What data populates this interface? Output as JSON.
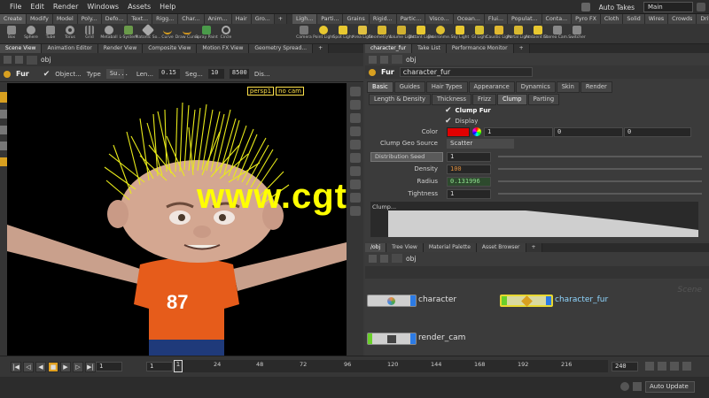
{
  "menubar": {
    "items": [
      "File",
      "Edit",
      "Render",
      "Windows",
      "Assets",
      "Help"
    ],
    "auto_takes": "Auto Takes",
    "desktop": "Main"
  },
  "shelf": {
    "left_tabs": [
      "Create",
      "Modify",
      "Model",
      "Poly...",
      "Defo...",
      "Text...",
      "Rigg...",
      "Char...",
      "Anim...",
      "Hair",
      "Gro..."
    ],
    "left_tools": [
      "Box",
      "Sphere",
      "Tube",
      "Torus",
      "Grid",
      "Metaball",
      "L-System",
      "Platonic So...",
      "Curve",
      "Draw Curve",
      "Spray Paint",
      "Circle"
    ],
    "right_tabs": [
      "Ligh...",
      "Parti...",
      "Grains",
      "Rigid...",
      "Partic...",
      "Visco...",
      "Ocean...",
      "Flui...",
      "Populat...",
      "Conta...",
      "Pyro FX",
      "Cloth",
      "Solid",
      "Wires",
      "Crowds",
      "Drive..."
    ],
    "right_tools": [
      "Camera",
      "Point Light",
      "Spot Light",
      "Area Light",
      "Geometry L...",
      "Volume Light",
      "Distant Light",
      "Environme...",
      "Sky Light",
      "GI Light",
      "Caustic Light",
      "Portal Light",
      "Ambient Li...",
      "Stereo Cam...",
      "Switcher"
    ]
  },
  "left_pane": {
    "tabs": [
      "Scene View",
      "Animation Editor",
      "Render View",
      "Composite View",
      "Motion FX View",
      "Geometry Spread..."
    ],
    "path": "obj",
    "toolbar": {
      "node": "Fur",
      "object_label": "Object...",
      "type_label": "Type",
      "type_value": "Su...",
      "length_label": "Len...",
      "length_value": "0.15",
      "segments_label": "Seg...",
      "segments_value": "10",
      "count_value": "8500",
      "dis_label": "Dis..."
    },
    "camera_menu": "persp1",
    "cam_menu": "no cam"
  },
  "param_pane": {
    "tabs": [
      "character_fur",
      "Take List",
      "Performance Monitor"
    ],
    "path": "obj",
    "node_type": "Fur",
    "node_name": "character_fur",
    "main_tabs": [
      "Basic",
      "Guides",
      "Hair Types",
      "Appearance",
      "Dynamics",
      "Skin",
      "Render"
    ],
    "sub_tabs": [
      "Length & Density",
      "Thickness",
      "Frizz",
      "Clump",
      "Parting"
    ],
    "active_sub_tab": "Clump",
    "params": {
      "clump_fur": "Clump Fur",
      "display": "Display",
      "color_label": "Color",
      "color_r": "1",
      "color_g": "0",
      "color_b": "0",
      "geo_source_label": "Clump Geo Source",
      "geo_source_value": "Scatter",
      "dist_seed_label": "Distribution Seed",
      "dist_seed_value": "1",
      "density_label": "Density",
      "density_value": "100",
      "radius_label": "Radius",
      "radius_value": "0.131996",
      "tightness_label": "Tightness",
      "tightness_value": "1",
      "clump_label": "Clump..."
    },
    "colors": {
      "swatch": "#e00000"
    }
  },
  "network_pane": {
    "tabs": [
      "/obj",
      "Tree View",
      "Material Palette",
      "Asset Browser"
    ],
    "path": "obj",
    "scene_label": "Scene",
    "nodes": [
      {
        "name": "character",
        "color": "#cfcfcf",
        "flag": "#2c7be5"
      },
      {
        "name": "character_fur",
        "color": "#d9d9a0",
        "flag": "#2c7be5"
      },
      {
        "name": "render_cam",
        "color": "#cfcfcf",
        "flag": "#2c7be5"
      }
    ]
  },
  "timeline": {
    "current_frame": "1",
    "start": "1",
    "end": "240",
    "ticks": [
      "1",
      "24",
      "48",
      "72",
      "96",
      "120",
      "144",
      "168",
      "192",
      "216"
    ]
  },
  "status": {
    "auto_update": "Auto Update"
  },
  "viewport": {
    "jersey_number": "87",
    "watermark": "www.cgtsj.com"
  }
}
